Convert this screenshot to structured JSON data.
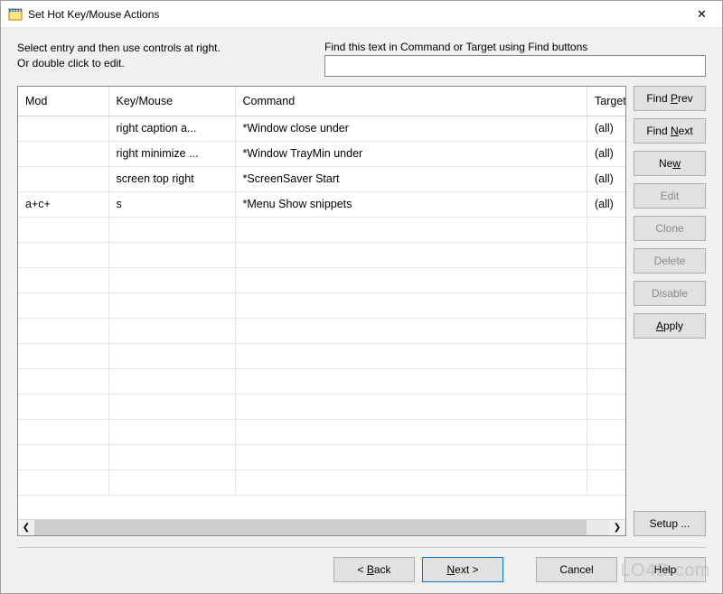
{
  "window": {
    "title": "Set Hot Key/Mouse Actions",
    "close_icon": "✕"
  },
  "instr": {
    "line1": "Select entry and then use controls at right.",
    "line2": "Or double click to edit."
  },
  "find": {
    "label": "Find this text in Command or Target using Find buttons",
    "value": ""
  },
  "columns": {
    "mod": "Mod",
    "key": "Key/Mouse",
    "command": "Command",
    "target": "Target"
  },
  "rows": [
    {
      "mod": "",
      "key": "right caption a...",
      "command": "*Window close under",
      "target": "(all)"
    },
    {
      "mod": "",
      "key": "right minimize ...",
      "command": "*Window TrayMin under",
      "target": "(all)"
    },
    {
      "mod": "",
      "key": "screen top right",
      "command": "*ScreenSaver Start",
      "target": "(all)"
    },
    {
      "mod": "a+c+",
      "key": "s",
      "command": "*Menu Show snippets",
      "target": "(all)"
    }
  ],
  "buttons": {
    "find_prev_pre": "Find ",
    "find_prev_acc": "P",
    "find_prev_post": "rev",
    "find_next_pre": "Find ",
    "find_next_acc": "N",
    "find_next_post": "ext",
    "new_pre": "Ne",
    "new_acc": "w",
    "new_post": "",
    "edit": "Edit",
    "clone": "Clone",
    "delete": "Delete",
    "disable": "Disable",
    "apply_pre": "",
    "apply_acc": "A",
    "apply_post": "pply",
    "setup": "Setup ..."
  },
  "wizard": {
    "back_pre": "< ",
    "back_acc": "B",
    "back_post": "ack",
    "next_pre": "",
    "next_acc": "N",
    "next_post": "ext >",
    "cancel": "Cancel",
    "help": "Help"
  },
  "scroll": {
    "left": "❮",
    "right": "❯"
  },
  "watermark": "LO4D.com"
}
